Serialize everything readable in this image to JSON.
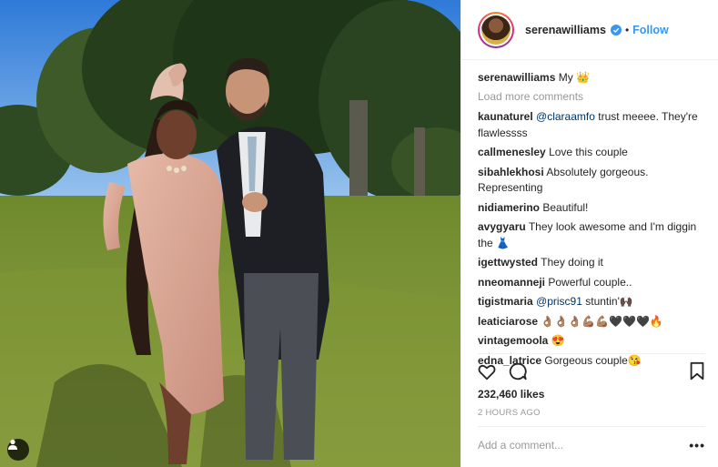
{
  "post": {
    "username": "serenawilliams",
    "verified_icon": "verified-badge-icon",
    "separator": "•",
    "follow_label": "Follow",
    "caption_user": "serenawilliams",
    "caption_text": "My 👑",
    "load_more": "Load more comments",
    "comments": [
      {
        "user": "kaunaturel",
        "mention": "@claraamfo",
        "text": " trust meeee. They're flawlessss"
      },
      {
        "user": "callmenesley",
        "mention": "",
        "text": "Love this couple"
      },
      {
        "user": "sibahlekhosi",
        "mention": "",
        "text": "Absolutely gorgeous. Representing"
      },
      {
        "user": "nidiamerino",
        "mention": "",
        "text": "Beautiful!"
      },
      {
        "user": "avygyaru",
        "mention": "",
        "text": "They look awesome and I'm diggin the 👗"
      },
      {
        "user": "igettwysted",
        "mention": "",
        "text": "They doing it"
      },
      {
        "user": "nneomanneji",
        "mention": "",
        "text": "Powerful couple.."
      },
      {
        "user": "tigistmaria",
        "mention": "@prisc91",
        "text": " stuntin'🙌🏿"
      },
      {
        "user": "leaticiarose",
        "mention": "",
        "text": "👌🏽👌🏽👌🏽💪🏽💪🏽🖤🖤🖤🔥"
      },
      {
        "user": "vintagemoola",
        "mention": "",
        "text": "😍"
      },
      {
        "user": "edna_latrice",
        "mention": "",
        "text": "Gorgeous couple😘"
      }
    ],
    "likes": "232,460 likes",
    "time": "2 HOURS AGO",
    "add_comment_placeholder": "Add a comment...",
    "more_options": "•••",
    "icons": {
      "like": "heart-icon",
      "comment": "comment-bubble-icon",
      "save": "bookmark-icon",
      "tag": "user-tag-icon"
    },
    "colors": {
      "accent": "#3897f0",
      "text": "#262626",
      "muted": "#999999",
      "border": "#efefef"
    }
  }
}
